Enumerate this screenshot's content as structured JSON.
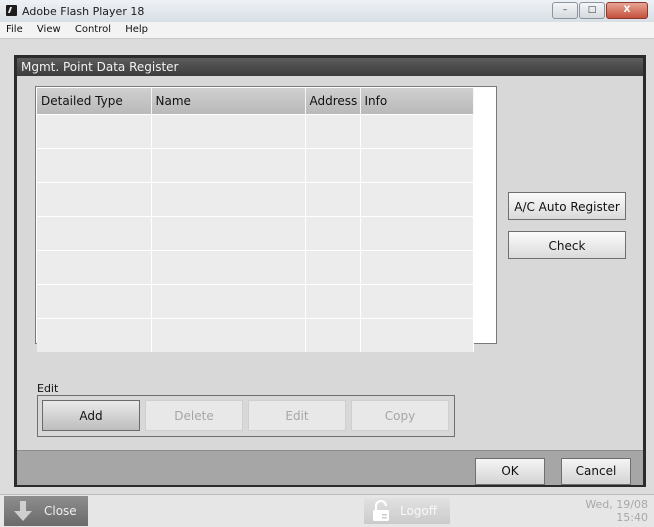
{
  "window": {
    "title": "Adobe Flash Player 18",
    "controls": {
      "minimize": "–",
      "maximize": "□",
      "close": "X"
    }
  },
  "menu": [
    "File",
    "View",
    "Control",
    "Help"
  ],
  "dialog": {
    "title": "Mgmt. Point Data Register",
    "table": {
      "columns": [
        "Detailed Type",
        "Name",
        "Address",
        "Info"
      ],
      "rows": [
        [
          "",
          "",
          "",
          ""
        ],
        [
          "",
          "",
          "",
          ""
        ],
        [
          "",
          "",
          "",
          ""
        ],
        [
          "",
          "",
          "",
          ""
        ],
        [
          "",
          "",
          "",
          ""
        ],
        [
          "",
          "",
          "",
          ""
        ],
        [
          "",
          "",
          "",
          ""
        ]
      ]
    },
    "side_buttons": {
      "auto_register": "A/C Auto Register",
      "check": "Check"
    },
    "edit": {
      "label": "Edit",
      "buttons": {
        "add": "Add",
        "delete": "Delete",
        "edit": "Edit",
        "copy": "Copy"
      }
    },
    "footer": {
      "ok": "OK",
      "cancel": "Cancel"
    }
  },
  "taskbar": {
    "close_label": "Close",
    "logoff_label": "Logoff",
    "date": "Wed, 19/08",
    "time": "15:40"
  }
}
